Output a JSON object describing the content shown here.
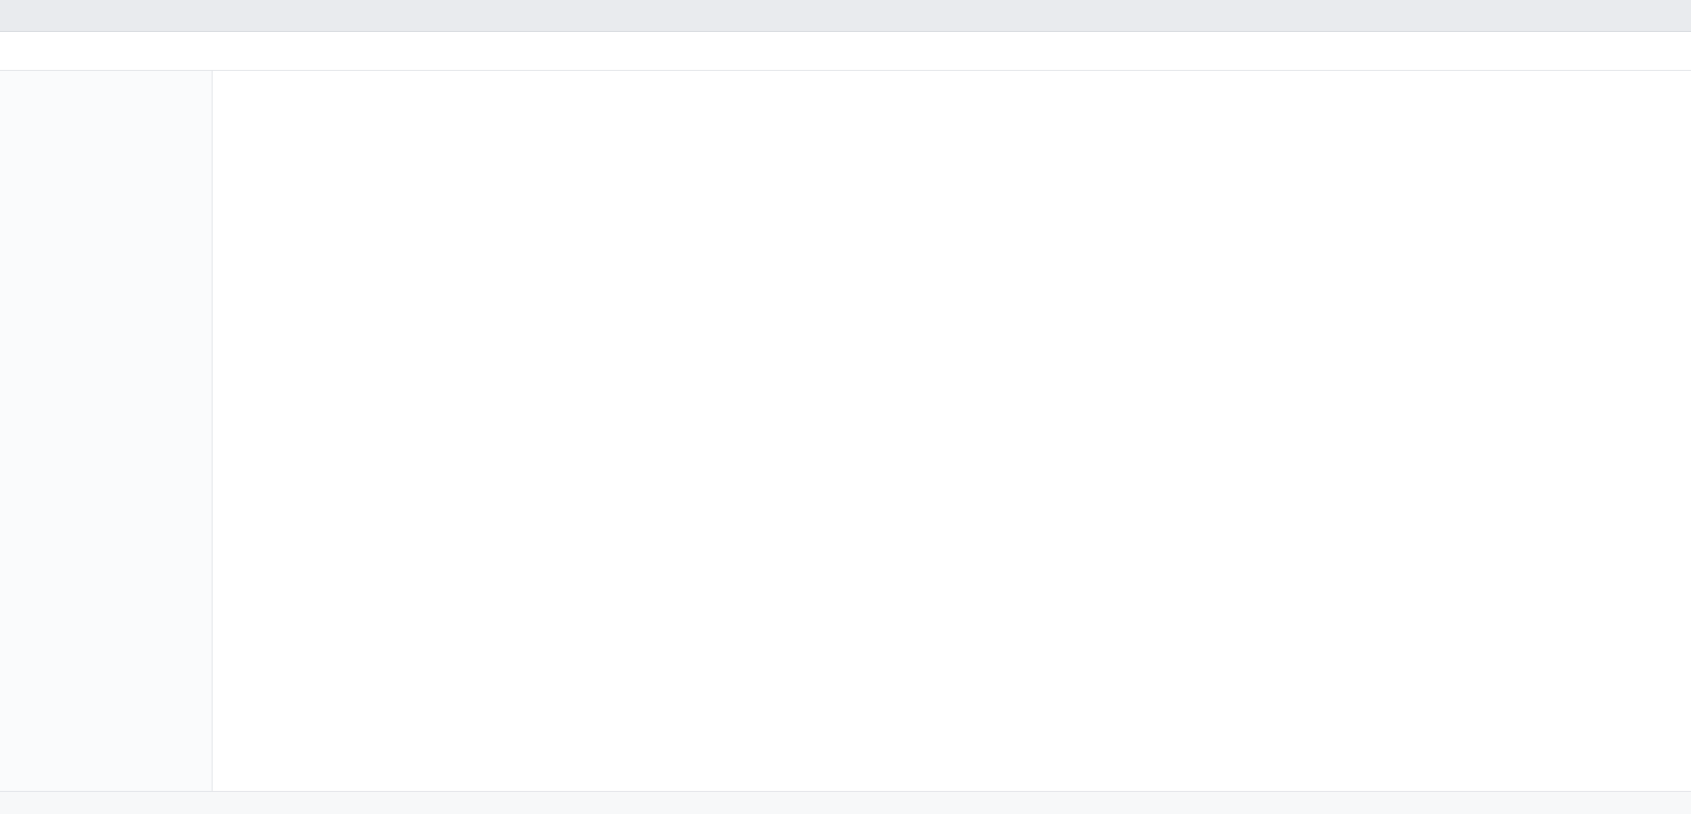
{
  "window": {
    "title": ""
  },
  "page": {
    "title": ""
  },
  "status": {
    "text": ""
  }
}
